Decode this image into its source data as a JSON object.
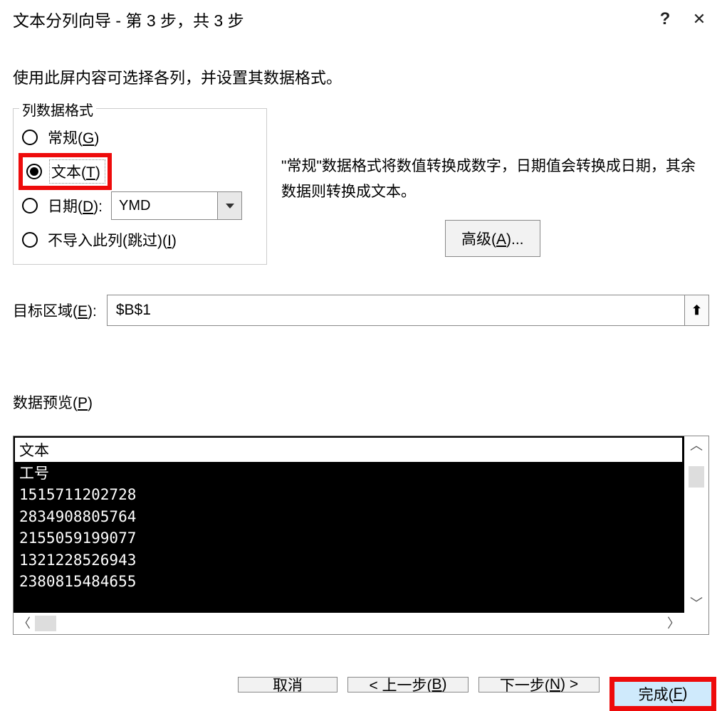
{
  "titlebar": {
    "title": "文本分列向导 - 第 3 步，共 3 步",
    "help": "?",
    "close": "✕"
  },
  "instruction": "使用此屏内容可选择各列，并设置其数据格式。",
  "formatGroup": {
    "legend": "列数据格式",
    "general": "常规(G)",
    "text": "文本(T)",
    "date": "日期(D):",
    "dateFormat": "YMD",
    "skip": "不导入此列(跳过)(I)"
  },
  "description": "\"常规\"数据格式将数值转换成数字，日期值会转换成日期，其余数据则转换成文本。",
  "advanced": "高级(A)...",
  "destination": {
    "label": "目标区域(E):",
    "value": "$B$1"
  },
  "preview": {
    "label": "数据预览(P)",
    "columnHeader": "文本",
    "rows": [
      "工号",
      "1515711202728",
      "2834908805764",
      "2155059199077",
      "1321228526943",
      "2380815484655"
    ]
  },
  "footer": {
    "cancel": "取消",
    "back": "上一步(B)",
    "next": "下一步(N)",
    "finish": "完成(F)"
  }
}
